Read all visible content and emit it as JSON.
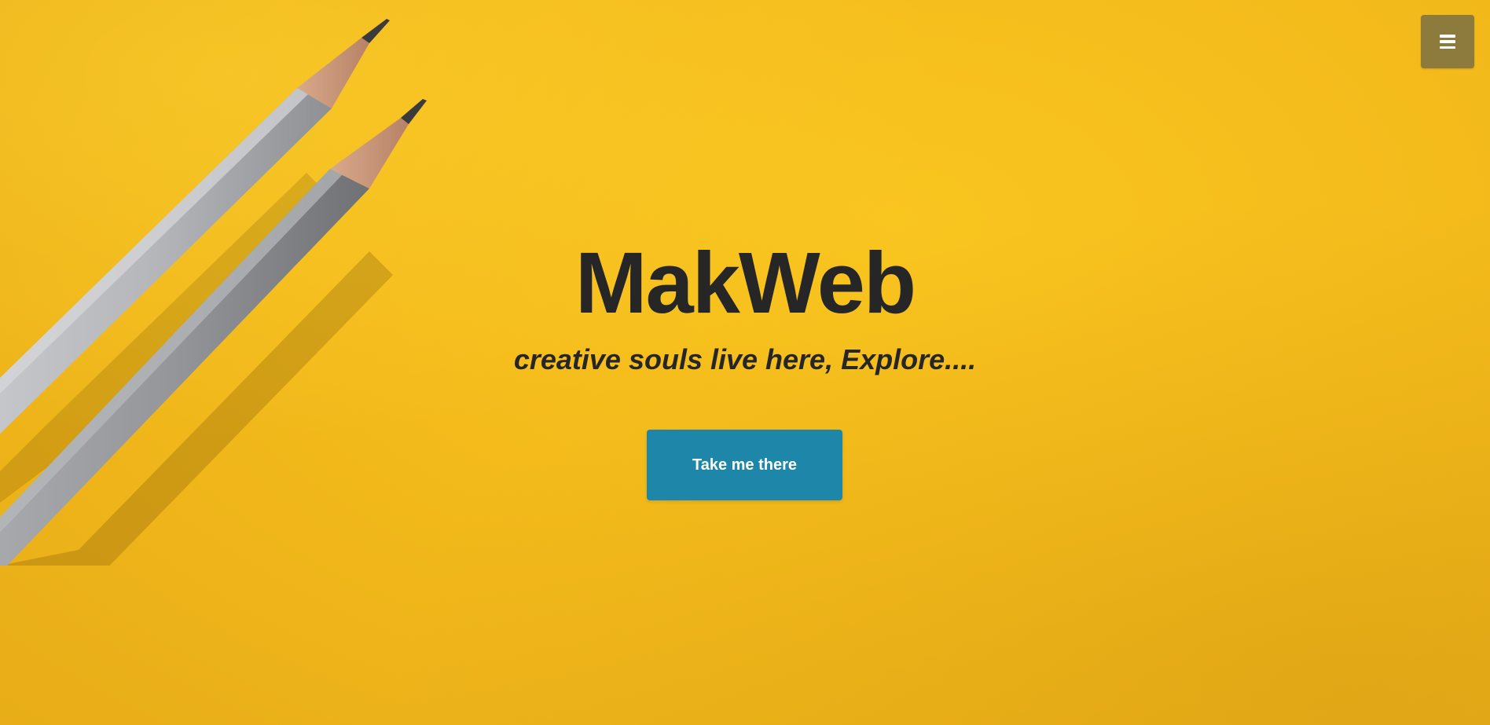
{
  "hero": {
    "title": "MakWeb",
    "subtitle": "creative souls live here, Explore....",
    "cta_label": "Take me there"
  },
  "header": {
    "menu_icon": "hamburger-menu-icon"
  },
  "colors": {
    "background": "#f4bb1b",
    "text": "#262626",
    "cta": "#1e86a8",
    "menu_button": "#8d7a3d"
  }
}
